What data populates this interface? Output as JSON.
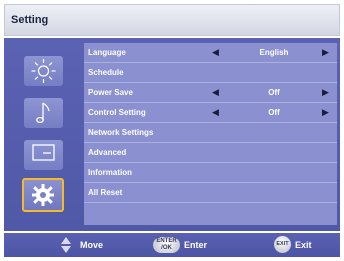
{
  "header": {
    "title": "Setting"
  },
  "icons": [
    {
      "name": "brightness-icon"
    },
    {
      "name": "music-note-icon"
    },
    {
      "name": "screen-icon"
    },
    {
      "name": "gear-icon",
      "selected": true
    }
  ],
  "menu": {
    "rows": [
      {
        "label": "Language",
        "value": "English",
        "has_arrows": true
      },
      {
        "label": "Schedule"
      },
      {
        "label": "Power Save",
        "value": "Off",
        "has_arrows": true
      },
      {
        "label": "Control Setting",
        "value": "Off",
        "has_arrows": true
      },
      {
        "label": "Network Settings"
      },
      {
        "label": "Advanced"
      },
      {
        "label": "Information"
      },
      {
        "label": "All Reset"
      }
    ],
    "left_arrow": "◀",
    "right_arrow": "▶"
  },
  "footer": {
    "move_label": "Move",
    "enter_key_top": "ENTER",
    "enter_key_bottom": "/OK",
    "enter_label": "Enter",
    "exit_key": "EXIT",
    "exit_label": "Exit"
  },
  "colors": {
    "panel": "#575fae",
    "menu_bg": "#8a90d0",
    "selection_border": "#f4b92c"
  }
}
